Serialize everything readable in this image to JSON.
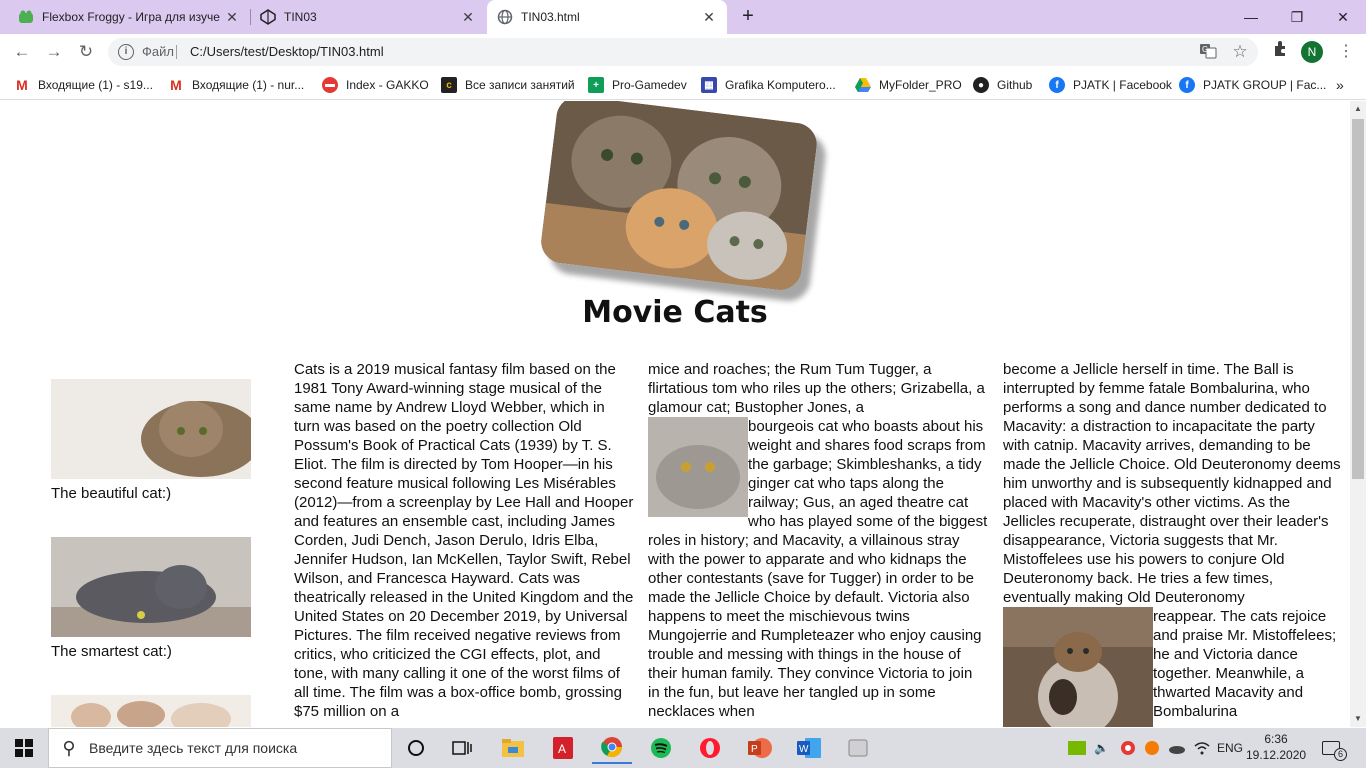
{
  "browser": {
    "tabs": [
      {
        "title": "Flexbox Froggy - Игра для изуче"
      },
      {
        "title": "TIN03"
      },
      {
        "title": "TIN03.html"
      }
    ],
    "address": {
      "label": "Файл",
      "url": "C:/Users/test/Desktop/TIN03.html"
    },
    "avatar_letter": "N",
    "bookmarks": [
      {
        "label": "Входящие (1) - s19...",
        "icon": "gmail-icon"
      },
      {
        "label": "Входящие (1) - nur...",
        "icon": "gmail-icon"
      },
      {
        "label": "Index - GAKKO",
        "icon": "gakko-icon"
      },
      {
        "label": "Все записи занятий",
        "icon": "records-icon"
      },
      {
        "label": "Pro-Gamedev",
        "icon": "sheets-icon"
      },
      {
        "label": "Grafika Komputero...",
        "icon": "grafika-icon"
      },
      {
        "label": "MyFolder_PRO",
        "icon": "drive-icon"
      },
      {
        "label": "Github",
        "icon": "github-icon"
      },
      {
        "label": "PJATK | Facebook",
        "icon": "facebook-icon"
      },
      {
        "label": "PJATK GROUP | Fac...",
        "icon": "facebook-icon"
      }
    ]
  },
  "page": {
    "title": "Movie Cats",
    "side_figures": [
      {
        "caption": "The beautiful cat:)"
      },
      {
        "caption": "The smartest cat:)"
      }
    ],
    "columns": [
      "Cats is a 2019 musical fantasy film based on the 1981 Tony Award-winning stage musical of the same name by Andrew Lloyd Webber, which in turn was based on the poetry collection Old Possum's Book of Practical Cats (1939) by T. S. Eliot. The film is directed by Tom Hooper—in his second feature musical following Les Misérables (2012)—from a screenplay by Lee Hall and Hooper and features an ensemble cast, including James Corden, Judi Dench, Jason Derulo, Idris Elba, Jennifer Hudson, Ian McKellen, Taylor Swift, Rebel Wilson, and Francesca Hayward. Cats was theatrically released in the United Kingdom and the United States on 20 December 2019, by Universal Pictures. The film received negative reviews from critics, who criticized the CGI effects, plot, and tone, with many calling it one of the worst films of all time. The film was a box-office bomb, grossing $75 million on a",
      {
        "before": "mice and roaches; the Rum Tum Tugger, a flirtatious tom who riles up the others; Grizabella, a glamour cat; Bustopher Jones, a",
        "after": "bourgeois cat who boasts about his weight and shares food scraps from the garbage; Skimbleshanks, a tidy ginger cat who taps along the railway; Gus, an aged theatre cat who has played some of the biggest roles in history; and Macavity, a villainous stray with the power to apparate and who kidnaps the other contestants (save for Tugger) in order to be made the Jellicle Choice by default. Victoria also happens to meet the mischievous twins Mungojerrie and Rumpleteazer who enjoy causing trouble and messing with things in the house of their human family. They convince Victoria to join in the fun, but leave her tangled up in some necklaces when"
      },
      {
        "before": "become a Jellicle herself in time. The Ball is interrupted by femme fatale Bombalurina, who performs a song and dance number dedicated to Macavity: a distraction to incapacitate the party with catnip. Macavity arrives, demanding to be made the Jellicle Choice. Old Deuteronomy deems him unworthy and is subsequently kidnapped and placed with Macavity's other victims. As the Jellicles recuperate, distraught over their leader's disappearance, Victoria suggests that Mr. Mistoffelees use his powers to conjure Old Deuteronomy back. He tries a few times, eventually making Old Deuteronomy",
        "after": "reappear. The cats rejoice and praise Mr. Mistoffelees; he and Victoria dance together. Meanwhile, a thwarted Macavity and Bombalurina"
      }
    ]
  },
  "taskbar": {
    "search_placeholder": "Введите здесь текст для поиска",
    "language": "ENG",
    "time": "6:36",
    "date": "19.12.2020",
    "notifications": "6"
  }
}
